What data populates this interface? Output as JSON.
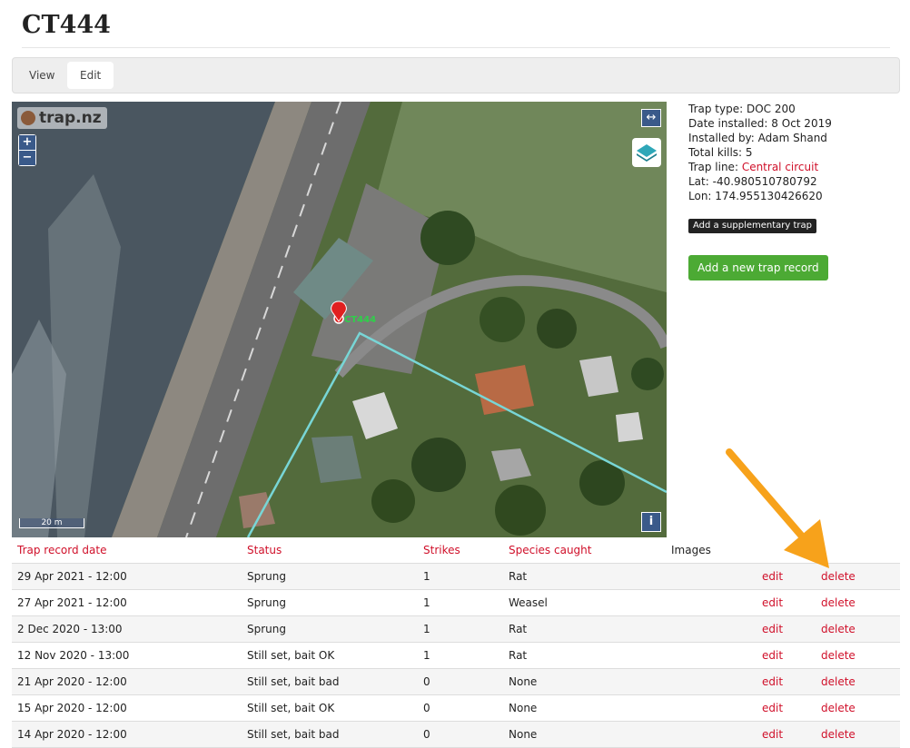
{
  "page": {
    "title": "CT444"
  },
  "tabs": [
    {
      "label": "View"
    },
    {
      "label": "Edit"
    }
  ],
  "map": {
    "logo_text": "trap.nz",
    "zoom_in": "+",
    "zoom_out": "−",
    "expand_icon": "↔",
    "info_icon": "i",
    "scale_label": "20 m",
    "trap_label": "CT444"
  },
  "trap_info": {
    "type_label": "Trap type:",
    "type_value": "DOC 200",
    "installed_label": "Date installed:",
    "installed_value": "8 Oct 2019",
    "installed_by_label": "Installed by:",
    "installed_by_value": "Adam Shand",
    "kills_label": "Total kills:",
    "kills_value": "5",
    "line_label": "Trap line:",
    "line_value": "Central circuit",
    "lat_label": "Lat:",
    "lat_value": "-40.980510780792",
    "lon_label": "Lon:",
    "lon_value": "174.955130426620",
    "supplementary_button": "Add a supplementary trap",
    "add_record_button": "Add a new trap record"
  },
  "table": {
    "headers": [
      "Trap record date",
      "Status",
      "Strikes",
      "Species caught",
      "Images"
    ],
    "edit_label": "edit",
    "delete_label": "delete",
    "rows": [
      {
        "date": "29 Apr 2021 - 12:00",
        "status": "Sprung",
        "strikes": "1",
        "species": "Rat"
      },
      {
        "date": "27 Apr 2021 - 12:00",
        "status": "Sprung",
        "strikes": "1",
        "species": "Weasel"
      },
      {
        "date": "2 Dec 2020 - 13:00",
        "status": "Sprung",
        "strikes": "1",
        "species": "Rat"
      },
      {
        "date": "12 Nov 2020 - 13:00",
        "status": "Still set, bait OK",
        "strikes": "1",
        "species": "Rat"
      },
      {
        "date": "21 Apr 2020 - 12:00",
        "status": "Still set, bait bad",
        "strikes": "0",
        "species": "None"
      },
      {
        "date": "15 Apr 2020 - 12:00",
        "status": "Still set, bait OK",
        "strikes": "0",
        "species": "None"
      },
      {
        "date": "14 Apr 2020 - 12:00",
        "status": "Still set, bait bad",
        "strikes": "0",
        "species": "None"
      }
    ]
  },
  "colors": {
    "accent_red": "#d0102a",
    "add_green": "#4caa34",
    "annotation_arrow": "#f7a21b"
  }
}
